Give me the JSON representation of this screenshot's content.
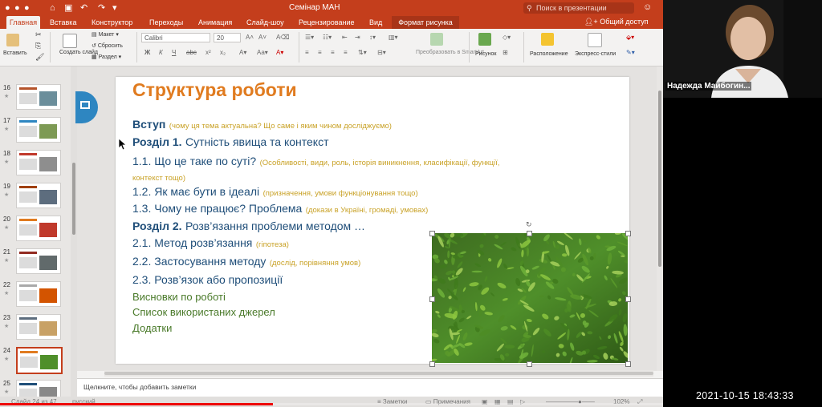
{
  "window": {
    "title": "Семінар МАН",
    "search_placeholder": "Поиск в презентации",
    "share_label": "Общий доступ"
  },
  "tabs": [
    {
      "label": "Главная",
      "active": true
    },
    {
      "label": "Вставка"
    },
    {
      "label": "Конструктор"
    },
    {
      "label": "Переходы"
    },
    {
      "label": "Анимация"
    },
    {
      "label": "Слайд-шоу"
    },
    {
      "label": "Рецензирование"
    },
    {
      "label": "Вид"
    },
    {
      "label": "Формат рисунка",
      "contextual": true
    }
  ],
  "ribbon": {
    "paste": "Вставить",
    "new_slide": "Создать слайд",
    "layout": "Макет",
    "reset": "Сбросить",
    "section": "Раздел",
    "font": "Calibri",
    "size": "20",
    "convert_smartart": "Преобразовать в SmartArt",
    "picture": "Рисунок",
    "arrange": "Расположение",
    "quick_styles": "Экспресс-стили"
  },
  "thumbnails": [
    {
      "num": "16"
    },
    {
      "num": "17"
    },
    {
      "num": "18"
    },
    {
      "num": "19"
    },
    {
      "num": "20"
    },
    {
      "num": "21"
    },
    {
      "num": "22"
    },
    {
      "num": "23"
    },
    {
      "num": "24",
      "selected": true
    },
    {
      "num": "25"
    }
  ],
  "slide": {
    "title": "Структура роботи",
    "lines": [
      {
        "main": "Вступ",
        "note": "(чому ця тема актуальна? Що саме і яким чином досліджуємо)",
        "style": "hb"
      },
      {
        "main": "Розділ 1.",
        "rest": "Сутність явища та контекст",
        "style": "hb"
      },
      {
        "main": "1.1. Що це таке по суті?",
        "note": "(Особливості, види, роль, історія виникнення, класифікації, функції,",
        "style": "h"
      },
      {
        "note": "контекст тощо)",
        "style": "h"
      },
      {
        "main": "1.2. Як має бути в ідеалі",
        "note": "(призначення, умови функціонування тощо)",
        "style": "h"
      },
      {
        "main": "1.3. Чому не працює? Проблема",
        "note": "(докази в Україні, громаді, умовах)",
        "style": "h"
      },
      {
        "main": "Розділ 2.",
        "rest": "Розв’язання проблеми методом …",
        "style": "hb"
      },
      {
        "main": "2.1. Метод розв’язання",
        "note": "(гіпотеза)",
        "style": "h"
      },
      {
        "main": "2.2. Застосування методу",
        "note": "(дослід, порівняння умов)",
        "style": "h"
      },
      {
        "main": "2.3. Розв’язок або пропозиції",
        "style": "h"
      },
      {
        "main": "Висновки по роботі",
        "style": "g"
      },
      {
        "main": "Список використаних джерел",
        "style": "g"
      },
      {
        "main": "Додатки",
        "style": "g"
      }
    ]
  },
  "notes_placeholder": "Щелкните, чтобы добавить заметки",
  "status": {
    "slide_info": "Слайд 24 из 47",
    "language": "русский",
    "notes": "Заметки",
    "comments": "Примечания",
    "zoom": "102%"
  },
  "webcam": {
    "name": "Надежда Майбогин...",
    "timestamp": "2021-10-15  18:43:33"
  },
  "colors": {
    "accent": "#c43e1c",
    "title": "#e07b1f",
    "heading": "#1f4e79",
    "note": "#c9a227",
    "green": "#4a7a2a"
  }
}
